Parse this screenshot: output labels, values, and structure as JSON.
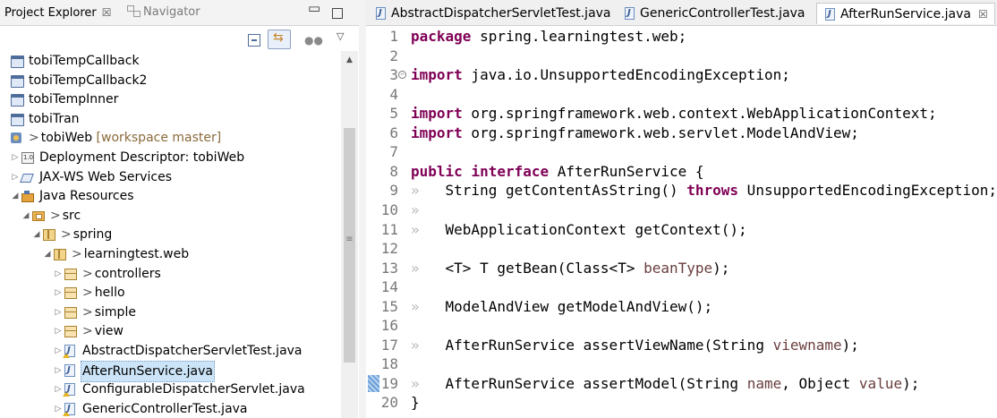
{
  "explorer": {
    "tab_label": "Project Explorer",
    "tab_close": "☒",
    "navigator_label": "Navigator",
    "minimize_glyph": "▭",
    "menu_glyph": "▽",
    "scroll_up_glyph": "▲",
    "scroll_grip_glyph": "≡",
    "tree": [
      {
        "label": "tobiTempCallback",
        "icon": "project-folder-icon",
        "indent": 0,
        "twisty": ""
      },
      {
        "label": "tobiTempCallback2",
        "icon": "project-folder-icon",
        "indent": 0,
        "twisty": ""
      },
      {
        "label": "tobiTempInner",
        "icon": "project-folder-icon",
        "indent": 0,
        "twisty": ""
      },
      {
        "label": "tobiTran",
        "icon": "project-folder-icon",
        "indent": 0,
        "twisty": ""
      },
      {
        "label": "tobiWeb",
        "icon": "web-project-icon",
        "indent": 0,
        "twisty": "",
        "prefix": ">",
        "decoration": "[workspace master]"
      },
      {
        "label": "Deployment Descriptor: tobiWeb",
        "icon": "deployment-descriptor-icon",
        "indent": 1,
        "twisty": "▷"
      },
      {
        "label": "JAX-WS Web Services",
        "icon": "jax-ws-icon",
        "indent": 1,
        "twisty": "▷"
      },
      {
        "label": "Java Resources",
        "icon": "java-resources-icon",
        "indent": 1,
        "twisty": "◢"
      },
      {
        "label": "src",
        "icon": "source-folder-icon",
        "indent": 2,
        "twisty": "◢",
        "prefix": ">"
      },
      {
        "label": "spring",
        "icon": "package-icon",
        "indent": 3,
        "twisty": "◢",
        "prefix": ">"
      },
      {
        "label": "learningtest.web",
        "icon": "package-icon",
        "indent": 4,
        "twisty": "◢",
        "prefix": ">"
      },
      {
        "label": "controllers",
        "icon": "package-open-icon",
        "indent": 5,
        "twisty": "▷",
        "prefix": ">"
      },
      {
        "label": "hello",
        "icon": "package-open-icon",
        "indent": 5,
        "twisty": "▷",
        "prefix": ">"
      },
      {
        "label": "simple",
        "icon": "package-open-icon",
        "indent": 5,
        "twisty": "▷",
        "prefix": ">"
      },
      {
        "label": "view",
        "icon": "package-open-icon",
        "indent": 5,
        "twisty": "▷",
        "prefix": ">"
      },
      {
        "label": "AbstractDispatcherServletTest.java",
        "icon": "java-file-warning-icon",
        "indent": 5,
        "twisty": "▷"
      },
      {
        "label": "AfterRunService.java",
        "icon": "java-file-icon",
        "indent": 5,
        "twisty": "▷",
        "selected": true
      },
      {
        "label": "ConfigurableDispatcherServlet.java",
        "icon": "java-file-warning-icon",
        "indent": 5,
        "twisty": "▷"
      },
      {
        "label": "GenericControllerTest.java",
        "icon": "java-file-warning-icon",
        "indent": 5,
        "twisty": "▷"
      }
    ]
  },
  "editor": {
    "tabs": [
      {
        "label": "AbstractDispatcherServletTest.java",
        "active": false
      },
      {
        "label": "GenericControllerTest.java",
        "active": false
      },
      {
        "label": "AfterRunService.java",
        "active": true,
        "close": "☒"
      }
    ],
    "lines": [
      {
        "n": "1",
        "code": [
          {
            "t": "package",
            "c": "kw"
          },
          {
            "t": " spring.learningtest.web;"
          }
        ]
      },
      {
        "n": "2",
        "code": []
      },
      {
        "n": "3",
        "fold": "⊖",
        "code": [
          {
            "t": "import",
            "c": "kw"
          },
          {
            "t": " java.io.UnsupportedEncodingException;"
          }
        ]
      },
      {
        "n": "4",
        "code": []
      },
      {
        "n": "5",
        "code": [
          {
            "t": "import",
            "c": "kw"
          },
          {
            "t": " org.springframework.web.context.WebApplicationContext;"
          }
        ]
      },
      {
        "n": "6",
        "code": [
          {
            "t": "import",
            "c": "kw"
          },
          {
            "t": " org.springframework.web.servlet.ModelAndView;"
          }
        ]
      },
      {
        "n": "7",
        "code": []
      },
      {
        "n": "8",
        "code": [
          {
            "t": "public",
            "c": "kw"
          },
          {
            "t": " "
          },
          {
            "t": "interface",
            "c": "kw"
          },
          {
            "t": " AfterRunService {"
          }
        ]
      },
      {
        "n": "9",
        "code": [
          {
            "t": "»   ",
            "c": "ws"
          },
          {
            "t": "String getContentAsString() "
          },
          {
            "t": "throws",
            "c": "kw"
          },
          {
            "t": " UnsupportedEncodingException;"
          }
        ]
      },
      {
        "n": "10",
        "code": [
          {
            "t": "»",
            "c": "ws"
          }
        ]
      },
      {
        "n": "11",
        "code": [
          {
            "t": "»   ",
            "c": "ws"
          },
          {
            "t": "WebApplicationContext getContext();"
          }
        ]
      },
      {
        "n": "12",
        "code": []
      },
      {
        "n": "13",
        "code": [
          {
            "t": "»   ",
            "c": "ws"
          },
          {
            "t": "<T> T getBean(Class<T> "
          },
          {
            "t": "beanType",
            "c": "par"
          },
          {
            "t": ");"
          }
        ]
      },
      {
        "n": "14",
        "code": []
      },
      {
        "n": "15",
        "code": [
          {
            "t": "»   ",
            "c": "ws"
          },
          {
            "t": "ModelAndView getModelAndView();"
          }
        ]
      },
      {
        "n": "16",
        "code": []
      },
      {
        "n": "17",
        "code": [
          {
            "t": "»   ",
            "c": "ws"
          },
          {
            "t": "AfterRunService assertViewName(String "
          },
          {
            "t": "viewname",
            "c": "par"
          },
          {
            "t": ");"
          }
        ]
      },
      {
        "n": "18",
        "code": []
      },
      {
        "n": "19",
        "marker": true,
        "code": [
          {
            "t": "»   ",
            "c": "ws"
          },
          {
            "t": "AfterRunService assertModel(String "
          },
          {
            "t": "name",
            "c": "par"
          },
          {
            "t": ", Object "
          },
          {
            "t": "value",
            "c": "par"
          },
          {
            "t": ");"
          }
        ]
      },
      {
        "n": "20",
        "code": [
          {
            "t": "}"
          }
        ]
      }
    ]
  }
}
